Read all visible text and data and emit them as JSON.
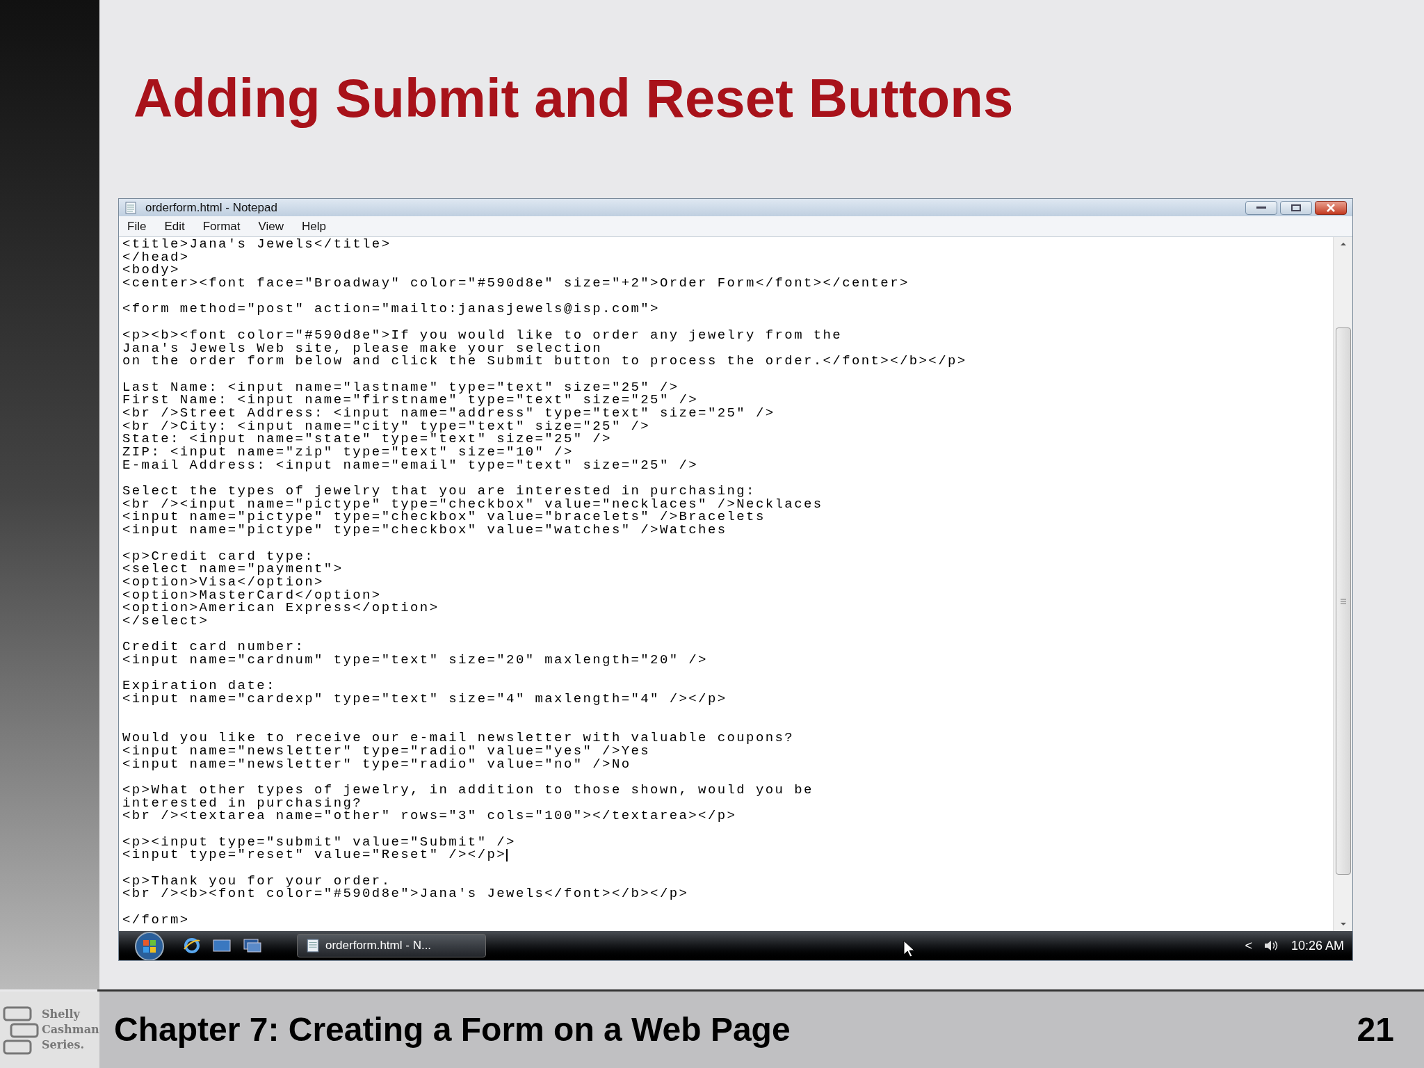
{
  "slide_title": "Adding Submit and Reset Buttons",
  "window": {
    "title": "orderform.html - Notepad",
    "menu": [
      "File",
      "Edit",
      "Format",
      "View",
      "Help"
    ],
    "code_blocks": [
      {
        "lines": [
          "<title>Jana's Jewels</title>",
          "</head>",
          "<body>",
          "<center><font face=\"Broadway\" color=\"#590d8e\" size=\"+2\">Order Form</font></center>"
        ]
      },
      {
        "lines": [
          "<form method=\"post\" action=\"mailto:janasjewels@isp.com\">"
        ]
      },
      {
        "lines": [
          "<p><b><font color=\"#590d8e\">If you would like to order any jewelry from the",
          "Jana's Jewels Web site, please make your selection",
          "on the order form below and click the Submit button to process the order.</font></b></p>"
        ]
      },
      {
        "lines": [
          "Last Name: <input name=\"lastname\" type=\"text\" size=\"25\" />",
          "First Name: <input name=\"firstname\" type=\"text\" size=\"25\" />",
          "<br />Street Address: <input name=\"address\" type=\"text\" size=\"25\" />",
          "<br />City: <input name=\"city\" type=\"text\" size=\"25\" />",
          "State: <input name=\"state\" type=\"text\" size=\"25\" />",
          "ZIP: <input name=\"zip\" type=\"text\" size=\"10\" />",
          "E-mail Address: <input name=\"email\" type=\"text\" size=\"25\" />"
        ]
      },
      {
        "lines": [
          "Select the types of jewelry that you are interested in purchasing:",
          "<br /><input name=\"pictype\" type=\"checkbox\" value=\"necklaces\" />Necklaces",
          "<input name=\"pictype\" type=\"checkbox\" value=\"bracelets\" />Bracelets",
          "<input name=\"pictype\" type=\"checkbox\" value=\"watches\" />Watches"
        ]
      },
      {
        "lines": [
          "<p>Credit card type:",
          "<select name=\"payment\">",
          "<option>Visa</option>",
          "<option>MasterCard</option>",
          "<option>American Express</option>",
          "</select>"
        ]
      },
      {
        "lines": [
          "Credit card number:",
          "<input name=\"cardnum\" type=\"text\" size=\"20\" maxlength=\"20\" />"
        ]
      },
      {
        "lines": [
          "Expiration date:",
          "<input name=\"cardexp\" type=\"text\" size=\"4\" maxlength=\"4\" /></p>"
        ]
      },
      {
        "extra_space": true,
        "lines": [
          "Would you like to receive our e-mail newsletter with valuable coupons?",
          "<input name=\"newsletter\" type=\"radio\" value=\"yes\" />Yes",
          "<input name=\"newsletter\" type=\"radio\" value=\"no\" />No"
        ]
      },
      {
        "lines": [
          "<p>What other types of jewelry, in addition to those shown, would you be",
          "interested in purchasing?",
          "<br /><textarea name=\"other\" rows=\"3\" cols=\"100\"></textarea></p>"
        ]
      },
      {
        "caret": true,
        "lines": [
          "<p><input type=\"submit\" value=\"Submit\" />",
          "<input type=\"reset\" value=\"Reset\" /></p>"
        ]
      },
      {
        "lines": [
          "<p>Thank you for your order.",
          "<br /><b><font color=\"#590d8e\">Jana's Jewels</font></b></p>"
        ]
      },
      {
        "lines": [
          "</form>"
        ]
      }
    ]
  },
  "taskbar": {
    "task": "orderform.html - N...",
    "tray_arrow": "<",
    "clock": "10:26 AM"
  },
  "footer": {
    "logo_lines": [
      "Shelly",
      "Cashman",
      "Series."
    ],
    "chapter": "Chapter 7: Creating a Form on a Web Page",
    "page_number": "21"
  }
}
